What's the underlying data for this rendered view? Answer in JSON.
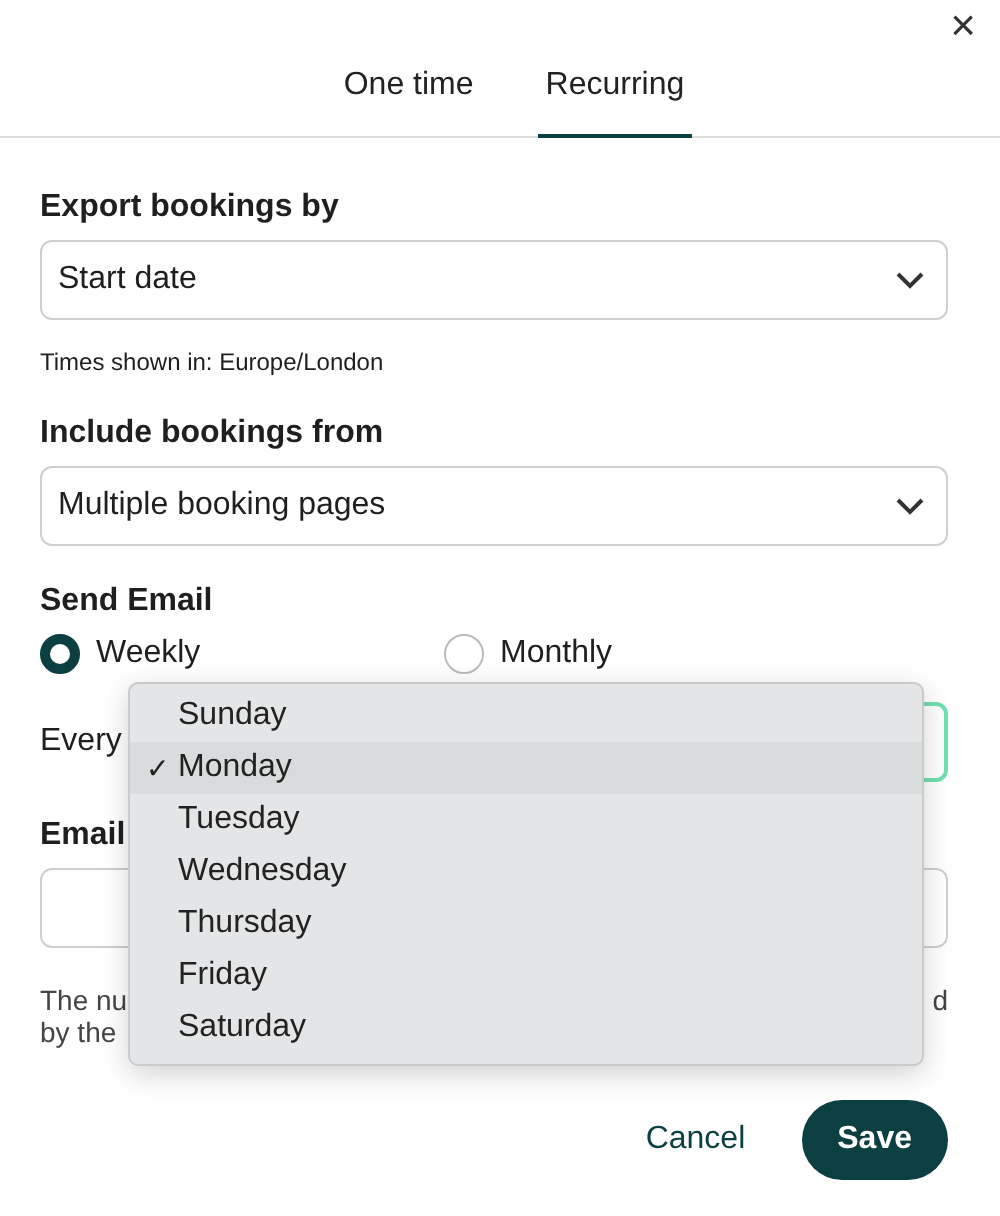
{
  "close": "×",
  "tabs": [
    {
      "label": "One time",
      "selected": false
    },
    {
      "label": "Recurring",
      "selected": true
    }
  ],
  "export_by": {
    "label": "Export bookings by",
    "value": "Start date",
    "hint": "Times shown in: Europe/London"
  },
  "include_from": {
    "label": "Include bookings from",
    "value": "Multiple booking pages"
  },
  "send_email": {
    "label": "Send Email",
    "options": [
      {
        "label": "Weekly",
        "selected": true
      },
      {
        "label": "Monthly",
        "selected": false
      }
    ],
    "every_label": "Every"
  },
  "email": {
    "label": "Email"
  },
  "note": {
    "start": "The nu",
    "end": "d",
    "second_line": "by the"
  },
  "day_menu": {
    "items": [
      {
        "label": "Sunday",
        "selected": false
      },
      {
        "label": "Monday",
        "selected": true
      },
      {
        "label": "Tuesday",
        "selected": false
      },
      {
        "label": "Wednesday",
        "selected": false
      },
      {
        "label": "Thursday",
        "selected": false
      },
      {
        "label": "Friday",
        "selected": false
      },
      {
        "label": "Saturday",
        "selected": false
      }
    ],
    "check": "✓"
  },
  "buttons": {
    "cancel": "Cancel",
    "save": "Save"
  }
}
